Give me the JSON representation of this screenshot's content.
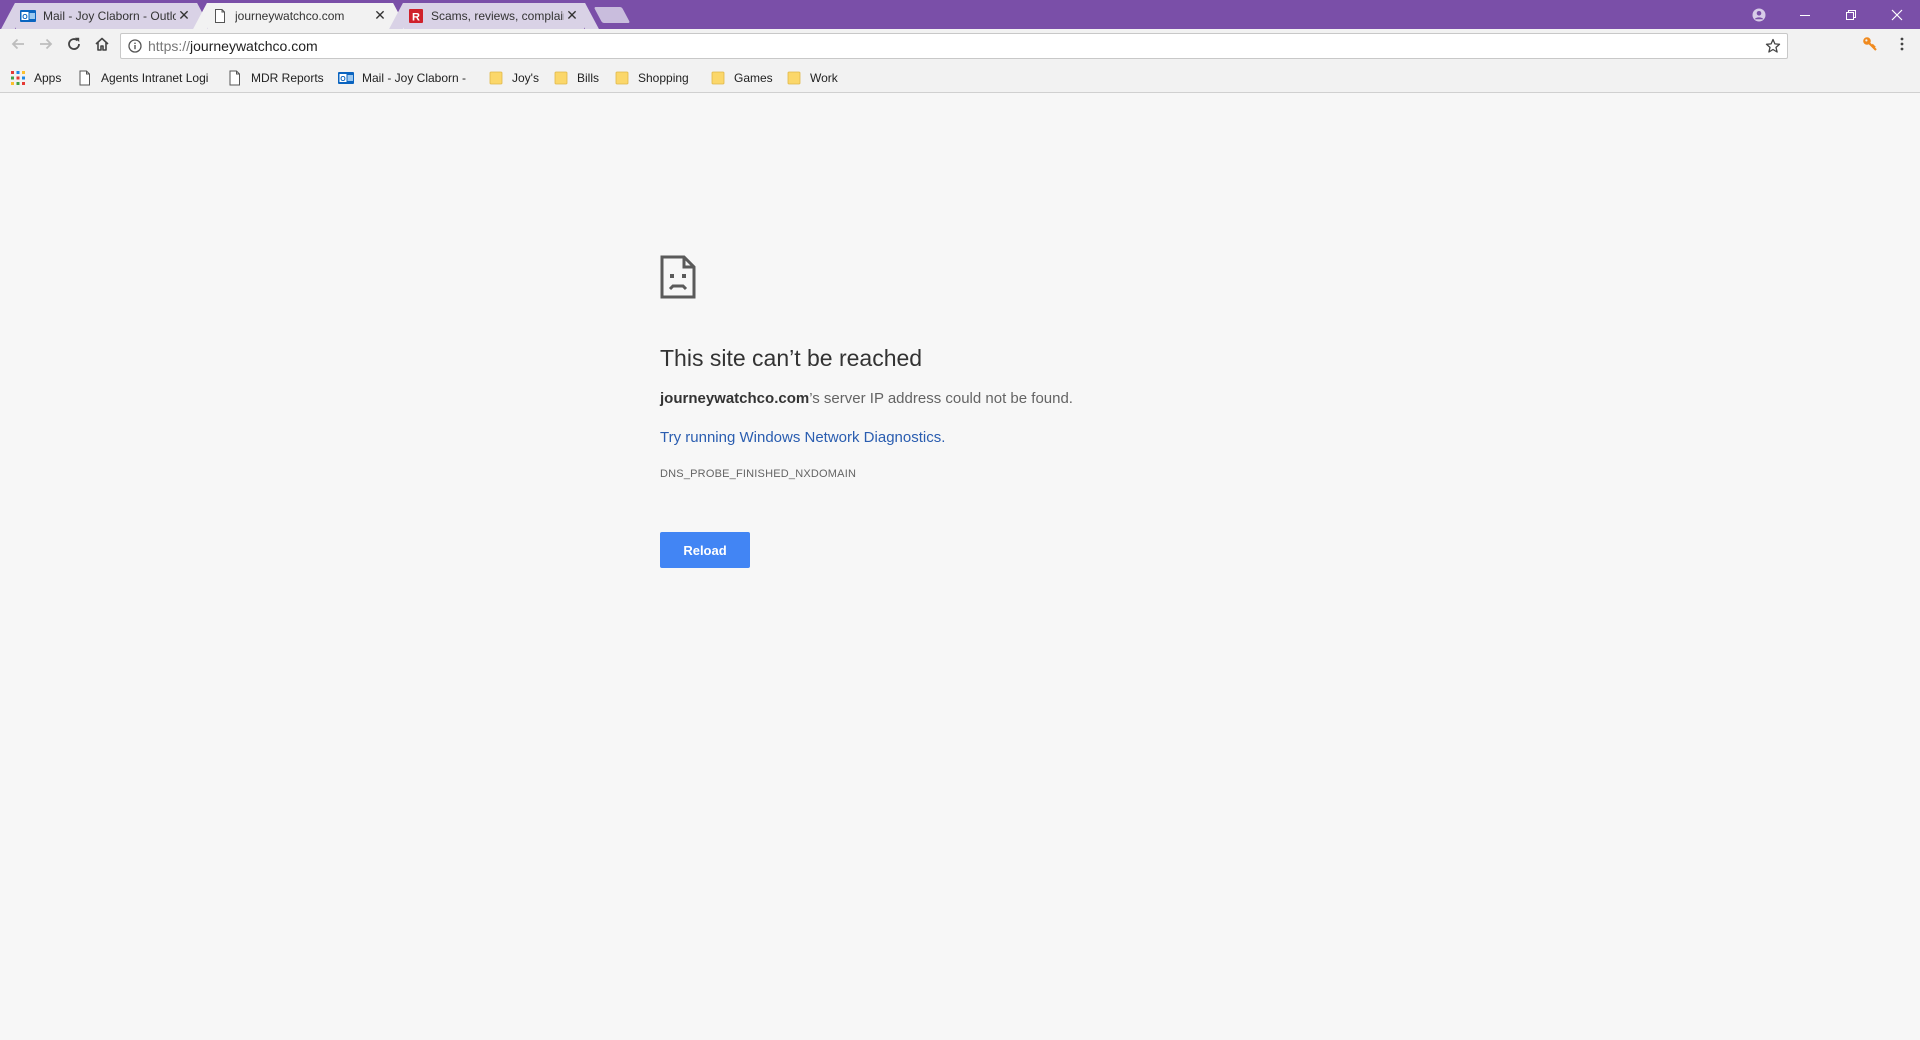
{
  "browser": {
    "tabs": [
      {
        "title": "Mail - Joy Claborn - Outlo",
        "icon": "outlook-icon",
        "active": false
      },
      {
        "title": "journeywatchco.com",
        "icon": "page-icon",
        "active": true
      },
      {
        "title": "Scams, reviews, complain",
        "icon": "ripoff-report-icon",
        "active": false
      }
    ],
    "tab_close_glyph": "✕",
    "window_controls": [
      "profile-icon",
      "minimize-icon",
      "restore-icon",
      "close-icon"
    ],
    "accent_color": "#7a4fa8"
  },
  "toolbar": {
    "url_scheme": "https://",
    "url_host": "journeywatchco.com"
  },
  "bookmarks": {
    "items": [
      {
        "label": "Apps",
        "icon": "apps-grid-icon"
      },
      {
        "label": "Agents Intranet Logi",
        "icon": "page-icon"
      },
      {
        "label": "MDR Reports",
        "icon": "page-icon"
      },
      {
        "label": "Mail - Joy Claborn -",
        "icon": "outlook-icon"
      },
      {
        "label": "Joy's",
        "icon": "folder-icon"
      },
      {
        "label": "Bills",
        "icon": "folder-icon"
      },
      {
        "label": "Shopping",
        "icon": "folder-icon"
      },
      {
        "label": "Games",
        "icon": "folder-icon"
      },
      {
        "label": "Work",
        "icon": "folder-icon"
      }
    ]
  },
  "error_page": {
    "title": "This site can’t be reached",
    "host": "journeywatchco.com",
    "detail_suffix": "’s server IP address could not be found.",
    "link_prefix": "Try running ",
    "link_text": "Windows Network Diagnostics",
    "link_suffix": ".",
    "error_code": "DNS_PROBE_FINISHED_NXDOMAIN",
    "reload_label": "Reload",
    "button_color": "#4285f4",
    "link_color": "#2a5db0"
  }
}
